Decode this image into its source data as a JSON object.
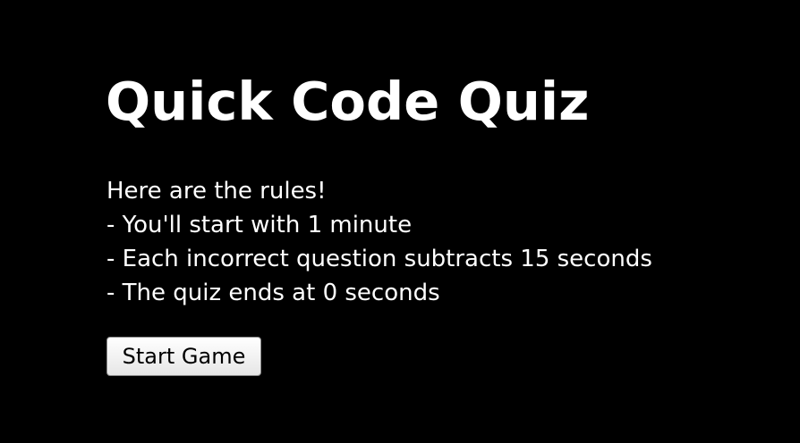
{
  "header": {
    "title": "Quick Code Quiz"
  },
  "rules": {
    "heading": "Here are the rules!",
    "items": [
      "- You'll start with 1 minute",
      "- Each incorrect question subtracts 15 seconds",
      "- The quiz ends at 0 seconds"
    ]
  },
  "actions": {
    "start_label": "Start Game"
  },
  "colors": {
    "background": "#000000",
    "text": "#ffffff"
  }
}
